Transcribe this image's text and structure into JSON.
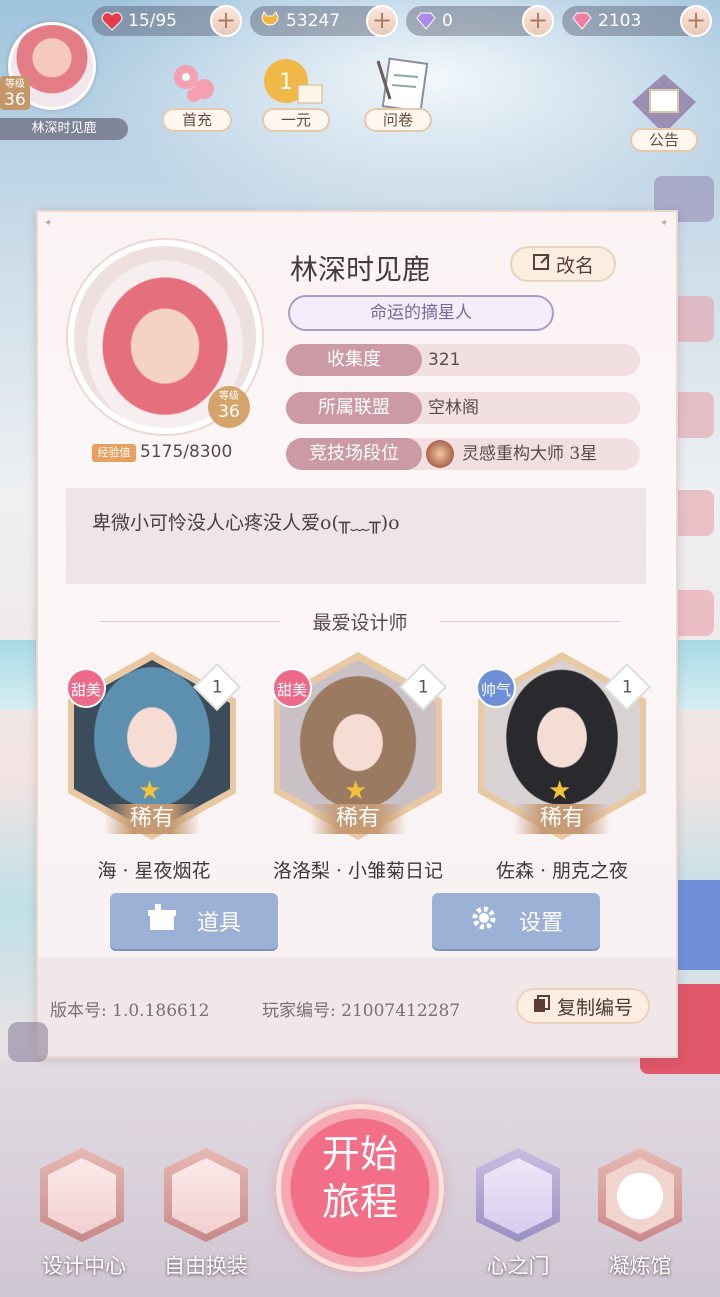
{
  "topbar": {
    "stamina": "15/95",
    "coins": "53247",
    "diamonds_purple": "0",
    "diamonds_pink": "2103"
  },
  "player_top": {
    "level_label": "等级",
    "level": "36",
    "name": "林深时见鹿"
  },
  "top_icons": [
    {
      "label": "首充"
    },
    {
      "label": "一元"
    },
    {
      "label": "问卷"
    }
  ],
  "notice_label": "公告",
  "profile": {
    "name": "林深时见鹿",
    "rename_label": "改名",
    "title": "命运的摘星人",
    "level_label": "等级",
    "level": "36",
    "exp_label": "经验值",
    "exp": "5175/8300",
    "rows": [
      {
        "label": "收集度",
        "value": "321"
      },
      {
        "label": "所属联盟",
        "value": "空林阁"
      },
      {
        "label": "竞技场段位",
        "value": "灵感重构大师 3星"
      }
    ],
    "signature": "卑微小可怜没人心疼没人爱o(╥﹏╥)o"
  },
  "favorites": {
    "title": "最爱设计师",
    "cards": [
      {
        "tag": "甜美",
        "count": "1",
        "rarity": "稀有",
        "name": "海 · 星夜烟花",
        "tag_color": "#ee6a8a"
      },
      {
        "tag": "甜美",
        "count": "1",
        "rarity": "稀有",
        "name": "洛洛梨 · 小雏菊日记",
        "tag_color": "#ee6a8a"
      },
      {
        "tag": "帅气",
        "count": "1",
        "rarity": "稀有",
        "name": "佐森 · 朋克之夜",
        "tag_color": "#6e8fd8"
      }
    ]
  },
  "buttons": {
    "items": "道具",
    "settings": "设置"
  },
  "footer": {
    "version": "版本号: 1.0.186612",
    "player_id": "玩家编号: 21007412287",
    "copy_label": "复制编号"
  },
  "nav": {
    "design_center": "设计中心",
    "free_dress": "自由换装",
    "start_line1": "开始",
    "start_line2": "旅程",
    "heart_gate": "心之门",
    "refinery": "凝炼馆"
  }
}
